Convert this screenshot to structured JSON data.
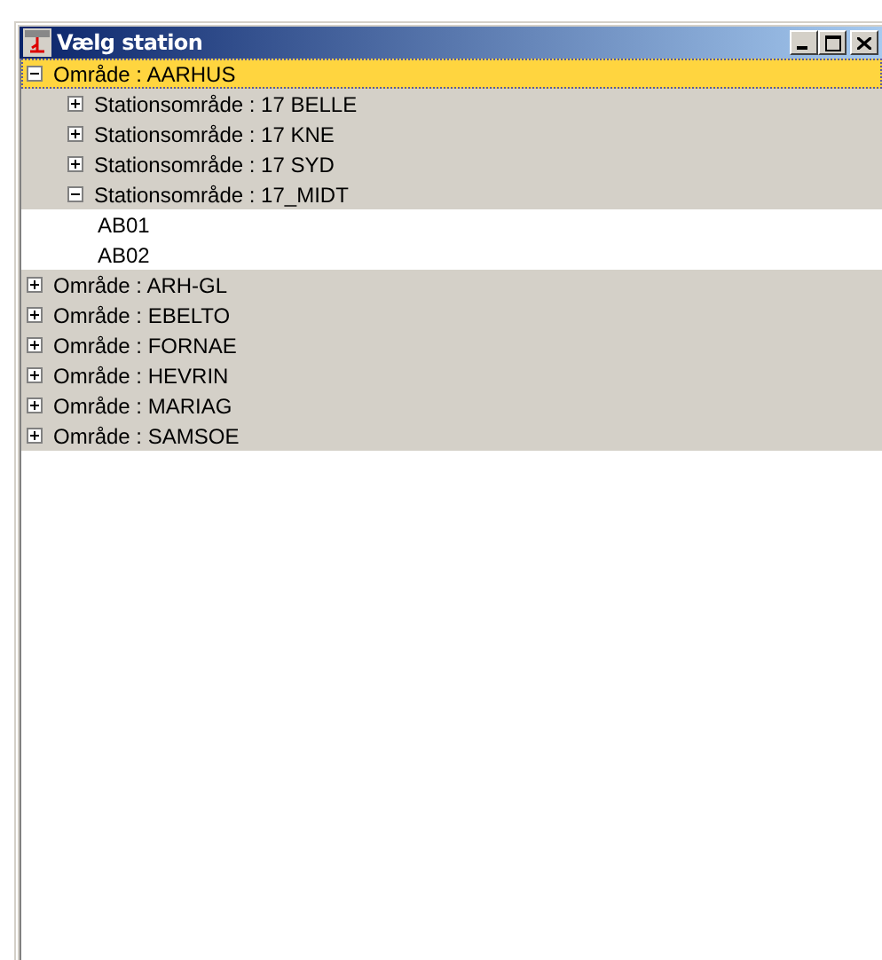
{
  "window": {
    "title": "Vælg station"
  },
  "tree": [
    {
      "label": "Område : AARHUS",
      "expanded": true,
      "selected": true,
      "children": [
        {
          "label": "Stationsområde : 17 BELLE",
          "expanded": false,
          "selected": false
        },
        {
          "label": "Stationsområde : 17 KNE",
          "expanded": false,
          "selected": false
        },
        {
          "label": "Stationsområde : 17 SYD",
          "expanded": false,
          "selected": false
        },
        {
          "label": "Stationsområde : 17_MIDT",
          "expanded": true,
          "selected": false,
          "children": [
            {
              "label": "AB01",
              "kind": "leaf",
              "selected": false
            },
            {
              "label": "AB02",
              "kind": "leaf",
              "selected": false
            }
          ]
        }
      ]
    },
    {
      "label": "Område : ARH-GL",
      "expanded": false,
      "selected": false
    },
    {
      "label": "Område : EBELTO",
      "expanded": false,
      "selected": false
    },
    {
      "label": "Område : FORNAE",
      "expanded": false,
      "selected": false
    },
    {
      "label": "Område : HEVRIN",
      "expanded": false,
      "selected": false
    },
    {
      "label": "Område : MARIAG",
      "expanded": false,
      "selected": false
    },
    {
      "label": "Område : SAMSOE",
      "expanded": false,
      "selected": false
    }
  ]
}
